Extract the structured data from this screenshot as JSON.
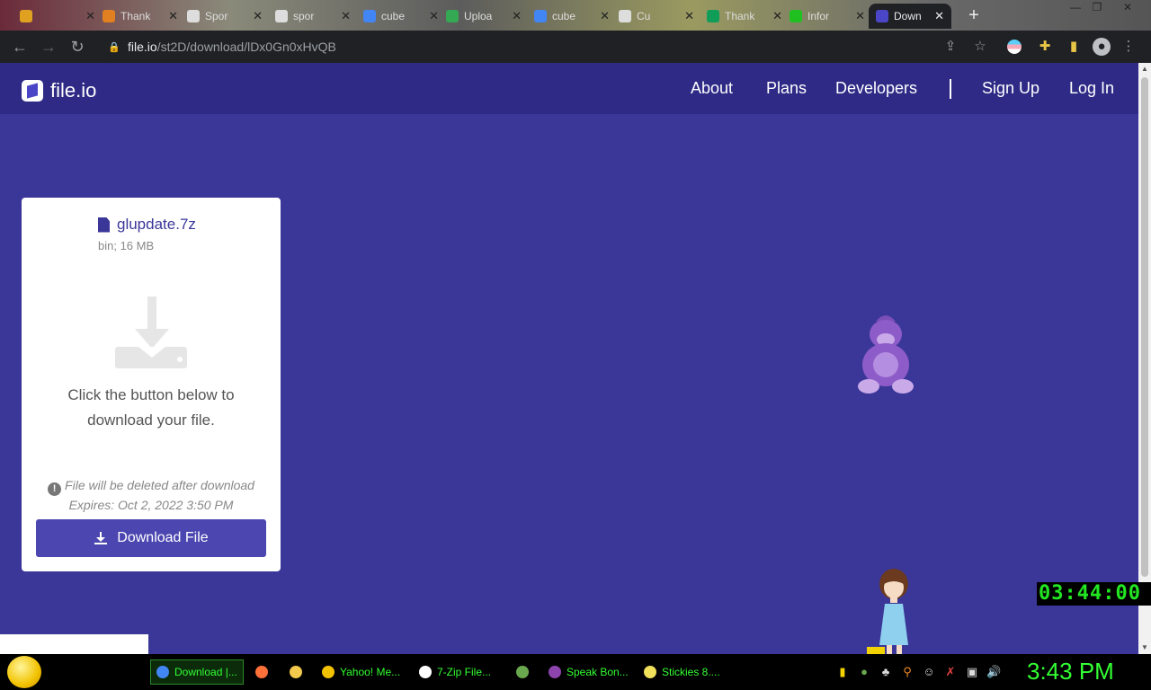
{
  "browser": {
    "tabs": [
      {
        "title": "",
        "color": "#e0a020"
      },
      {
        "title": "Thank",
        "color": "#e08020"
      },
      {
        "title": "Spor",
        "color": "#dddddd"
      },
      {
        "title": "spor",
        "color": "#dddddd"
      },
      {
        "title": "cube",
        "color": "#4285f4"
      },
      {
        "title": "Uploa",
        "color": "#34a853"
      },
      {
        "title": "cube",
        "color": "#4285f4"
      },
      {
        "title": "Cu",
        "color": "#dddddd"
      },
      {
        "title": "Thank",
        "color": "#0f9d58"
      },
      {
        "title": "Infor",
        "color": "#20c020"
      }
    ],
    "active_tab": {
      "title": "Down"
    },
    "url_host": "file.io",
    "url_path": "/st2D/download/lDx0Gn0xHvQB"
  },
  "site": {
    "logo_text": "file.io",
    "nav": {
      "about": "About",
      "plans": "Plans",
      "developers": "Developers",
      "signup": "Sign Up",
      "login": "Log In"
    }
  },
  "file": {
    "name": "glupdate.7z",
    "meta": "bin; 16 MB",
    "message": "Click the button below to download your file.",
    "delete_notice": "File will be deleted after download",
    "expires": "Expires: Oct 2, 2022 3:50 PM",
    "button_label": "Download File"
  },
  "desktop": {
    "led_clock": "03:44:00",
    "taskbar": [
      {
        "label": "Download |...",
        "icon": "chrome-icon",
        "color": "#4285f4"
      },
      {
        "label": "",
        "icon": "firefox-icon",
        "color": "#ff7139"
      },
      {
        "label": "",
        "icon": "folder-icon",
        "color": "#f2c94c"
      },
      {
        "label": "Yahoo! Me...",
        "icon": "yahoo-messenger-icon",
        "color": "#f2c200"
      },
      {
        "label": "7-Zip File...",
        "icon": "7zip-icon",
        "color": "#ffffff"
      },
      {
        "label": "",
        "icon": "globe-icon",
        "color": "#6aa84f"
      },
      {
        "label": "Speak Bon...",
        "icon": "bonzi-icon",
        "color": "#8e44ad"
      },
      {
        "label": "Stickies 8....",
        "icon": "stickies-icon",
        "color": "#f1e05a"
      }
    ],
    "tray_time": "3:43 PM"
  }
}
